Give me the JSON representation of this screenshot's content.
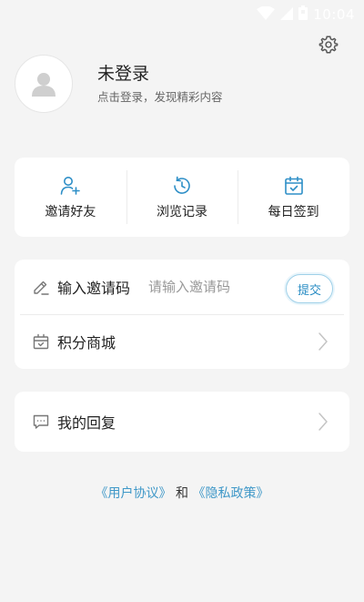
{
  "status_bar": {
    "time": "10:04"
  },
  "profile": {
    "title": "未登录",
    "subtitle": "点击登录，发现精彩内容"
  },
  "actions": [
    {
      "label": "邀请好友",
      "icon": "add-user-icon"
    },
    {
      "label": "浏览记录",
      "icon": "history-icon"
    },
    {
      "label": "每日签到",
      "icon": "calendar-check-icon"
    }
  ],
  "invite": {
    "label": "输入邀请码",
    "placeholder": "请输入邀请码",
    "submit_label": "提交"
  },
  "mall": {
    "label": "积分商城"
  },
  "reply": {
    "label": "我的回复"
  },
  "footer": {
    "user_agreement": "《用户协议》",
    "and": "和",
    "privacy_policy": "《隐私政策》"
  },
  "colors": {
    "accent": "#3f98c8",
    "background": "#f4f4f4",
    "card": "#ffffff"
  }
}
